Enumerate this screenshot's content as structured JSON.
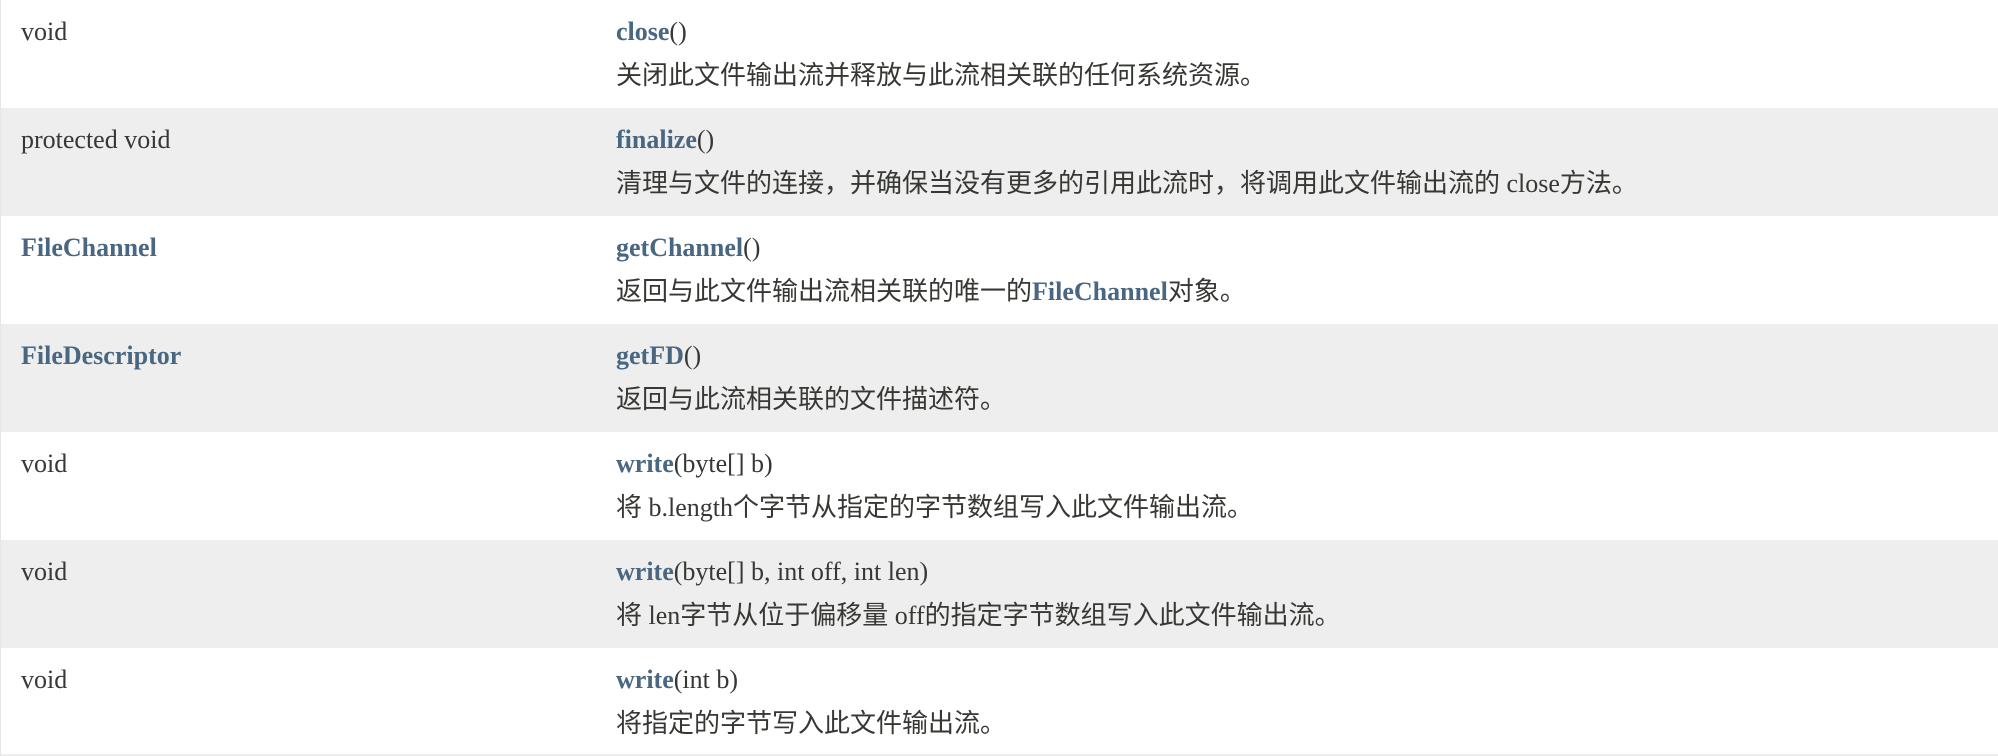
{
  "methods": [
    {
      "modifier": "void",
      "modifier_is_link": false,
      "name": "close",
      "params": "()",
      "description": "关闭此文件输出流并释放与此流相关联的任何系统资源。"
    },
    {
      "modifier": "protected void",
      "modifier_is_link": false,
      "name": "finalize",
      "params": "()",
      "description": "清理与文件的连接，并确保当没有更多的引用此流时，将调用此文件输出流的 close方法。"
    },
    {
      "modifier": "FileChannel",
      "modifier_is_link": true,
      "name": "getChannel",
      "params": "()",
      "description_before": "返回与此文件输出流相关联的唯一的",
      "description_link": "FileChannel",
      "description_after": "对象。"
    },
    {
      "modifier": "FileDescriptor",
      "modifier_is_link": true,
      "name": "getFD",
      "params": "()",
      "description": "返回与此流相关联的文件描述符。"
    },
    {
      "modifier": "void",
      "modifier_is_link": false,
      "name": "write",
      "params": "(byte[] b)",
      "description": "将 b.length个字节从指定的字节数组写入此文件输出流。"
    },
    {
      "modifier": "void",
      "modifier_is_link": false,
      "name": "write",
      "params": "(byte[] b, int off, int len)",
      "description": "将 len字节从位于偏移量 off的指定字节数组写入此文件输出流。"
    },
    {
      "modifier": "void",
      "modifier_is_link": false,
      "name": "write",
      "params": "(int b)",
      "description": "将指定的字节写入此文件输出流。"
    }
  ],
  "colors": {
    "link": "#4a6782",
    "text": "#353833",
    "alt_row": "#eeeeee",
    "row": "#ffffff"
  }
}
